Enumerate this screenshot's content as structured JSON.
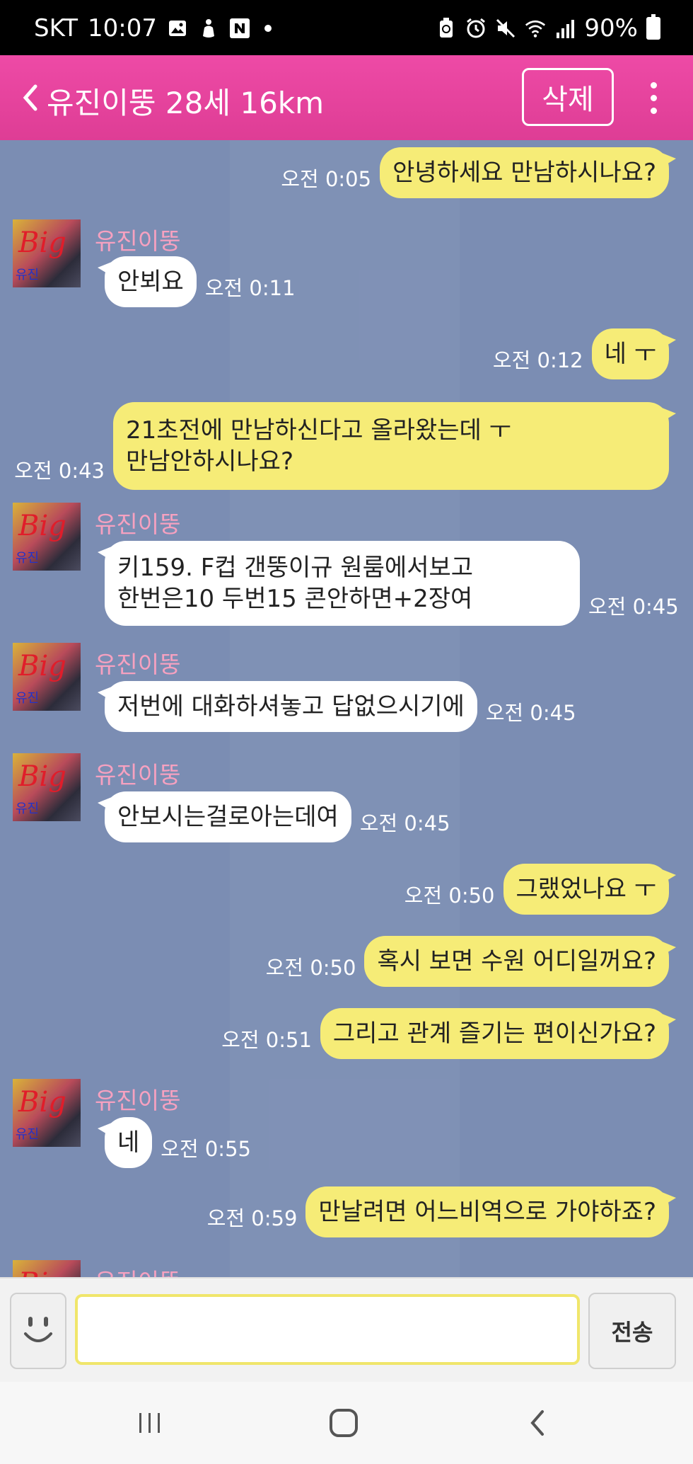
{
  "status_bar": {
    "carrier": "SKT",
    "time": "10:07",
    "notification_icons": [
      "image-icon",
      "hand-icon",
      "naver-icon"
    ],
    "battery": "90%",
    "system_icons": [
      "recycle-icon",
      "alarm-icon",
      "mute-icon",
      "wifi-icon",
      "signal-icon",
      "battery-icon"
    ]
  },
  "header": {
    "title": "유진이뚱 28세 16km",
    "delete_label": "삭제",
    "accent_color": "#e8449e"
  },
  "messages": [
    {
      "dir": "sent",
      "text": "안녕하세요 만남하시나요?",
      "time": "오전 0:05"
    },
    {
      "dir": "received",
      "sender": "유진이뚱",
      "lines": [
        "안뵈요"
      ],
      "time": "오전 0:11"
    },
    {
      "dir": "sent",
      "text": "네 ㅜ",
      "time": "오전 0:12"
    },
    {
      "dir": "sent",
      "lines": [
        "21초전에 만남하신다고 올라왔는데  ㅜ",
        "만남안하시나요?"
      ],
      "time": "오전 0:43"
    },
    {
      "dir": "received",
      "sender": "유진이뚱",
      "lines": [
        "키159. F컵 갠뚱이규 원룸에서보고",
        "한번은10  두번15  콘안하면+2장여"
      ],
      "time": "오전 0:45"
    },
    {
      "dir": "received",
      "sender": "유진이뚱",
      "lines": [
        "저번에 대화하셔놓고 답없으시기에"
      ],
      "time": "오전 0:45"
    },
    {
      "dir": "received",
      "sender": "유진이뚱",
      "lines": [
        "안보시는걸로아는데여"
      ],
      "time": "오전 0:45"
    },
    {
      "dir": "sent",
      "text": "그랬었나요 ㅜ",
      "time": "오전 0:50"
    },
    {
      "dir": "sent",
      "text": "혹시 보면 수원 어디일꺼요?",
      "time": "오전 0:50"
    },
    {
      "dir": "sent",
      "text": "그리고 관계 즐기는 편이신가요?",
      "time": "오전 0:51"
    },
    {
      "dir": "received",
      "sender": "유진이뚱",
      "lines": [
        "네"
      ],
      "time": "오전 0:55"
    },
    {
      "dir": "sent",
      "text": "만날려면 어느비역으로 가야하죠?",
      "time": "오전 0:59"
    },
    {
      "dir": "received",
      "sender": "유진이뚱",
      "lines": [],
      "time": ""
    }
  ],
  "input": {
    "value": "",
    "send_label": "전송"
  },
  "nav": {
    "icons": [
      "recent-apps-icon",
      "home-icon",
      "back-icon"
    ]
  }
}
